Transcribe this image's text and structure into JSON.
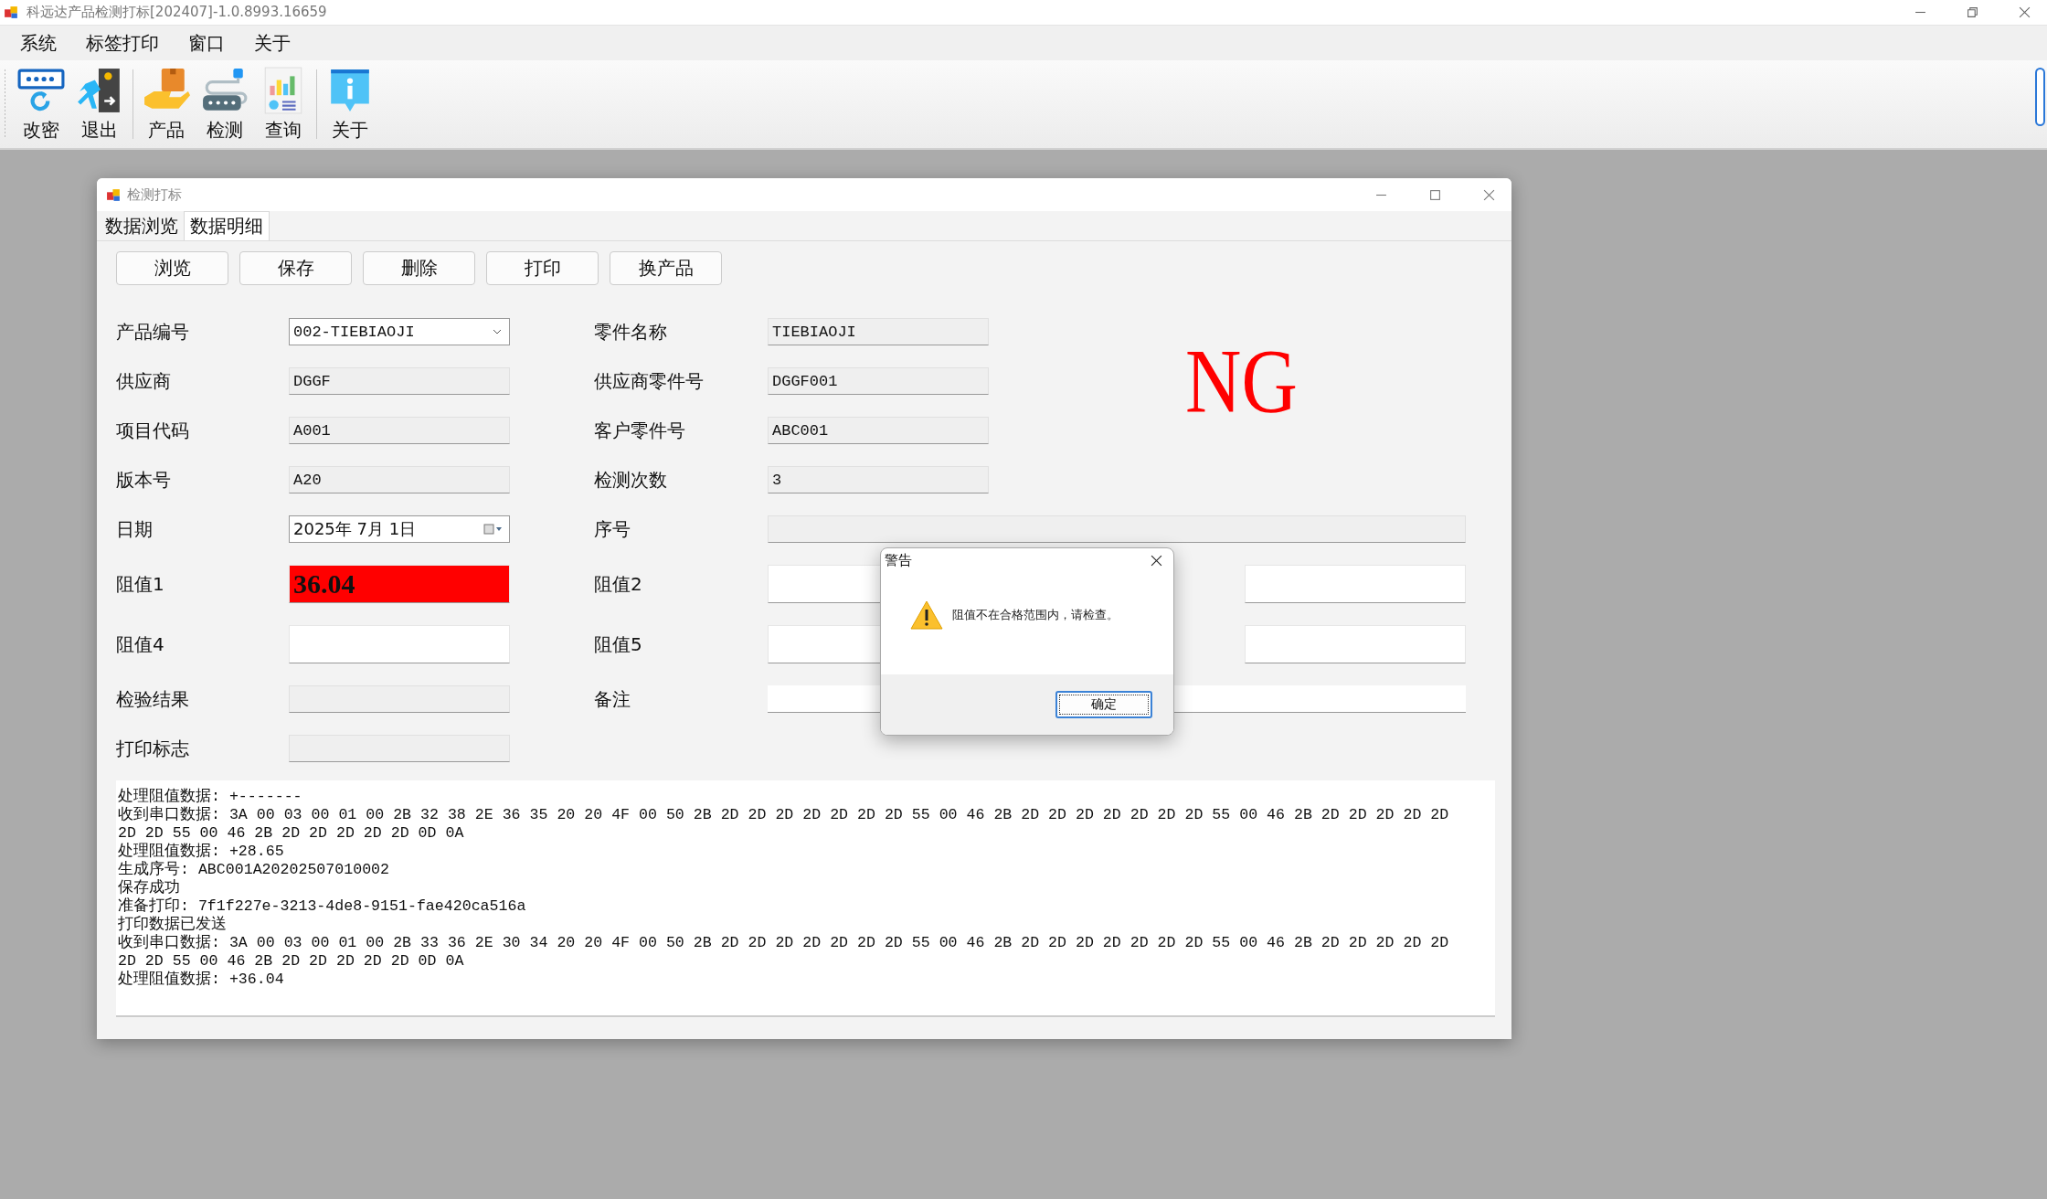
{
  "window": {
    "title": "科远达产品检测打标[202407]-1.0.8993.16659"
  },
  "menu": [
    "系统",
    "标签打印",
    "窗口",
    "关于"
  ],
  "toolbar": [
    {
      "label": "改密",
      "kind": "password",
      "separator_after": false
    },
    {
      "label": "退出",
      "kind": "exit",
      "separator_after": true
    },
    {
      "label": "产品",
      "kind": "product",
      "separator_after": false
    },
    {
      "label": "检测",
      "kind": "device",
      "separator_after": false
    },
    {
      "label": "查询",
      "kind": "report",
      "separator_after": true
    },
    {
      "label": "关于",
      "kind": "info",
      "separator_after": false
    }
  ],
  "child": {
    "title": "检测打标",
    "tabs": [
      {
        "label": "数据浏览",
        "selected": false
      },
      {
        "label": "数据明细",
        "selected": true
      }
    ],
    "buttons": [
      "浏览",
      "保存",
      "删除",
      "打印",
      "换产品"
    ],
    "result": "NG",
    "rows": [
      {
        "items": [
          {
            "label": "产品编号",
            "field": {
              "kind": "dropdown",
              "value": "002-TIEBIAOJI",
              "readonly": false
            }
          },
          {
            "label": "零件名称",
            "field": {
              "kind": "text",
              "value": "TIEBIAOJI",
              "readonly": true
            }
          }
        ]
      },
      {
        "items": [
          {
            "label": "供应商",
            "field": {
              "kind": "text",
              "value": "DGGF",
              "readonly": true
            }
          },
          {
            "label": "供应商零件号",
            "field": {
              "kind": "text",
              "value": "DGGF001",
              "readonly": true
            }
          }
        ]
      },
      {
        "items": [
          {
            "label": "项目代码",
            "field": {
              "kind": "text",
              "value": "A001",
              "readonly": true
            }
          },
          {
            "label": "客户零件号",
            "field": {
              "kind": "text",
              "value": "ABC001",
              "readonly": true
            }
          }
        ]
      },
      {
        "items": [
          {
            "label": "版本号",
            "field": {
              "kind": "text",
              "value": "A20",
              "readonly": true
            }
          },
          {
            "label": "检测次数",
            "field": {
              "kind": "text",
              "value": "3",
              "readonly": true
            }
          }
        ]
      },
      {
        "items": [
          {
            "label": "日期",
            "field": {
              "kind": "date",
              "value": "2025年 7月 1日",
              "readonly": false
            }
          },
          {
            "label": "序号",
            "field": {
              "kind": "wide",
              "readonly": true
            }
          }
        ]
      },
      {
        "items": [
          {
            "label": "阻值1",
            "field": {
              "kind": "reading",
              "value": "36.04",
              "alarm": true,
              "readonly": false
            }
          },
          {
            "label": "阻值2",
            "field": {
              "kind": "reading",
              "alarm": false,
              "readonly": false
            }
          },
          {
            "field": {
              "kind": "reading",
              "alarm": false,
              "readonly": false
            }
          }
        ]
      },
      {
        "items": [
          {
            "label": "阻值4",
            "field": {
              "kind": "reading",
              "alarm": false,
              "readonly": false
            }
          },
          {
            "label": "阻值5",
            "field": {
              "kind": "reading",
              "alarm": false,
              "readonly": false
            }
          },
          {
            "field": {
              "kind": "reading",
              "alarm": false,
              "readonly": false
            }
          }
        ]
      },
      {
        "items": [
          {
            "label": "检验结果",
            "field": {
              "kind": "text",
              "readonly": true
            }
          },
          {
            "label": "备注",
            "field": {
              "kind": "wide",
              "readonly": false
            }
          }
        ]
      },
      {
        "items": [
          {
            "label": "打印标志",
            "field": {
              "kind": "text",
              "readonly": true
            }
          }
        ]
      }
    ],
    "log": [
      "处理阻值数据: +-------",
      "收到串口数据: 3A 00 03 00 01 00 2B 32 38 2E 36 35 20 20 4F 00 50 2B 2D 2D 2D 2D 2D 2D 2D 55 00 46 2B 2D 2D 2D 2D 2D 2D 2D 55 00 46 2B 2D 2D 2D 2D 2D",
      "2D 2D 55 00 46 2B 2D 2D 2D 2D 2D 0D 0A",
      "处理阻值数据: +28.65",
      "生成序号: ABC001A20202507010002",
      "保存成功",
      "准备打印: 7f1f227e-3213-4de8-9151-fae420ca516a",
      "打印数据已发送",
      "收到串口数据: 3A 00 03 00 01 00 2B 33 36 2E 30 34 20 20 4F 00 50 2B 2D 2D 2D 2D 2D 2D 2D 55 00 46 2B 2D 2D 2D 2D 2D 2D 2D 55 00 46 2B 2D 2D 2D 2D 2D",
      "2D 2D 55 00 46 2B 2D 2D 2D 2D 2D 0D 0A",
      "处理阻值数据: +36.04"
    ]
  },
  "dialog": {
    "title": "警告",
    "message": "阻值不在合格范围内，请检查。",
    "button": "确定"
  }
}
